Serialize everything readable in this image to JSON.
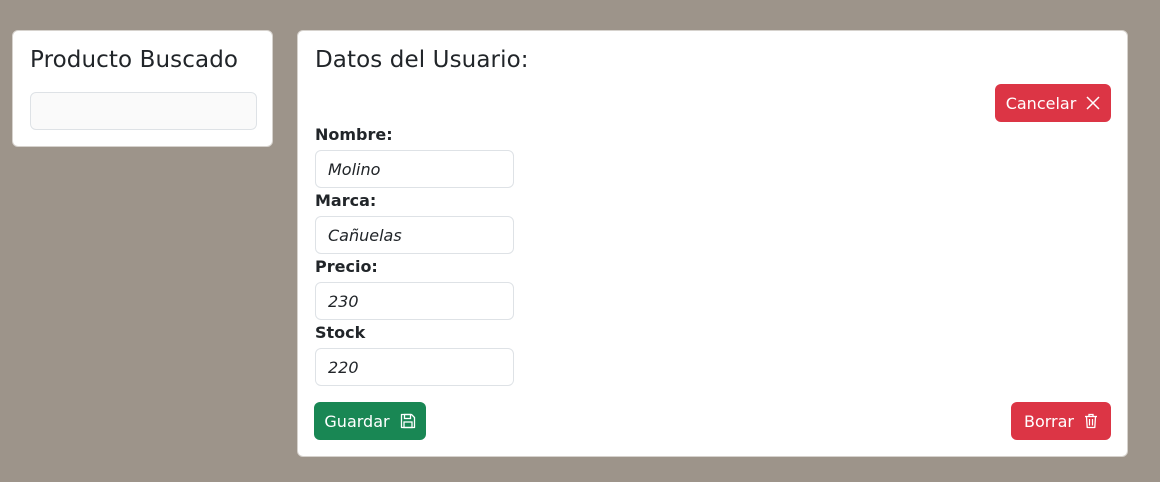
{
  "search_card": {
    "title": "Producto Buscado",
    "search_value": ""
  },
  "user_card": {
    "title": "Datos del Usuario:",
    "cancel_label": "Cancelar",
    "fields": {
      "nombre": {
        "label": "Nombre:",
        "value": "Molino"
      },
      "marca": {
        "label": "Marca:",
        "value": "Cañuelas"
      },
      "precio": {
        "label": "Precio:",
        "value": "230"
      },
      "stock": {
        "label": "Stock",
        "value": "220"
      }
    },
    "save_label": "Guardar",
    "delete_label": "Borrar"
  },
  "icons": {
    "cancel": "close-icon",
    "save": "save-icon",
    "delete": "trash-icon"
  },
  "colors": {
    "background": "#9d948a",
    "danger": "#dc3545",
    "success": "#198754"
  }
}
